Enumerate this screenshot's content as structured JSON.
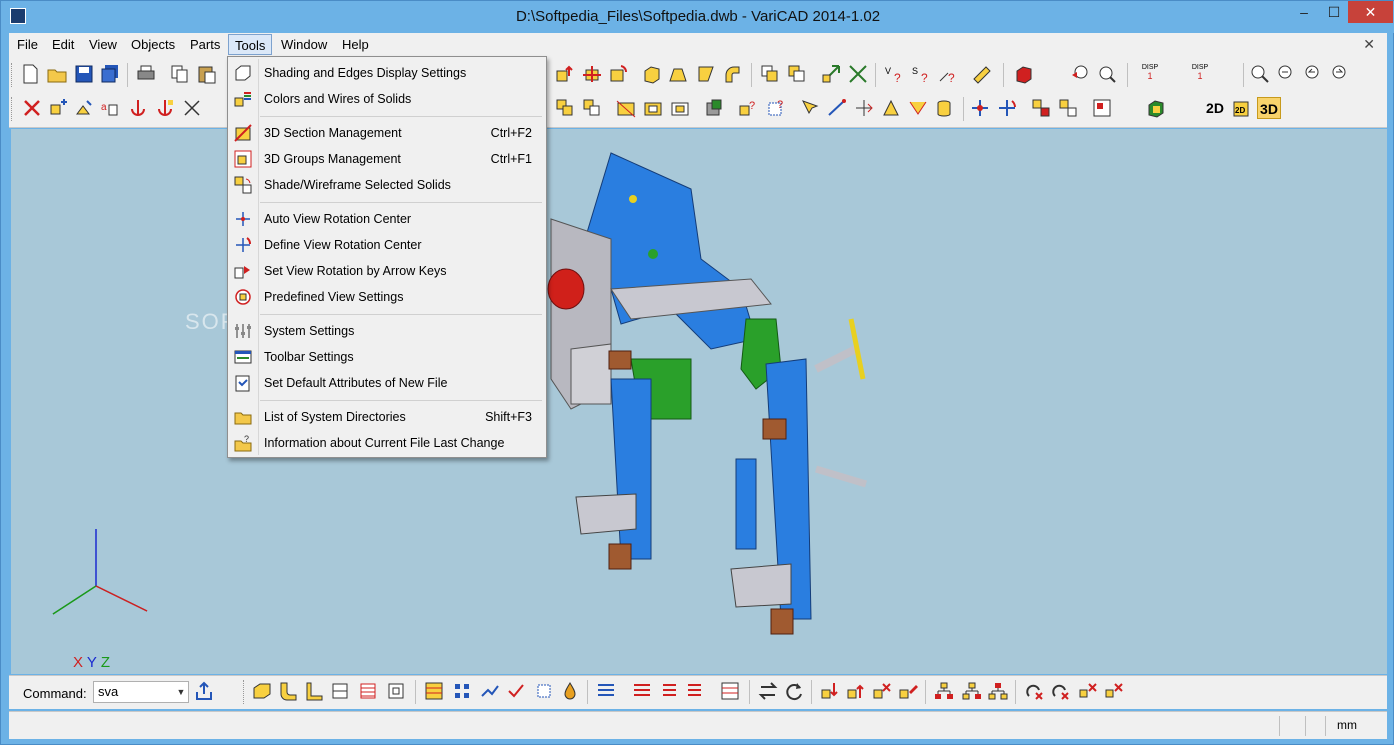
{
  "window": {
    "title": "D:\\Softpedia_Files\\Softpedia.dwb - VariCAD 2014-1.02",
    "min_glyph": "–",
    "max_glyph": "☐",
    "close_glyph": "✕",
    "mdi_close_glyph": "✕"
  },
  "menubar": {
    "items": [
      {
        "label": "File"
      },
      {
        "label": "Edit"
      },
      {
        "label": "View"
      },
      {
        "label": "Objects"
      },
      {
        "label": "Parts"
      },
      {
        "label": "Tools",
        "active": true
      },
      {
        "label": "Window"
      },
      {
        "label": "Help"
      }
    ]
  },
  "tools_menu": {
    "items": [
      {
        "label": "Shading and Edges Display Settings",
        "shortcut": "",
        "icon": "shading-icon"
      },
      {
        "label": "Colors and Wires of Solids",
        "shortcut": "",
        "icon": "colors-icon"
      },
      {
        "label": "3D Section Management",
        "shortcut": "Ctrl+F2",
        "icon": "section-icon"
      },
      {
        "label": "3D Groups Management",
        "shortcut": "Ctrl+F1",
        "icon": "groups-icon"
      },
      {
        "label": "Shade/Wireframe Selected Solids",
        "shortcut": "",
        "icon": "shade-wire-icon"
      },
      {
        "label": "Auto View Rotation Center",
        "shortcut": "",
        "icon": "auto-rotation-icon"
      },
      {
        "label": "Define View Rotation Center",
        "shortcut": "",
        "icon": "define-rotation-icon"
      },
      {
        "label": "Set View Rotation by Arrow Keys",
        "shortcut": "",
        "icon": "arrow-keys-icon"
      },
      {
        "label": "Predefined View Settings",
        "shortcut": "",
        "icon": "predefined-view-icon"
      },
      {
        "label": "System Settings",
        "shortcut": "",
        "icon": "system-settings-icon"
      },
      {
        "label": "Toolbar Settings",
        "shortcut": "",
        "icon": "toolbar-settings-icon"
      },
      {
        "label": "Set Default Attributes of New File",
        "shortcut": "",
        "icon": "default-attributes-icon"
      },
      {
        "label": "List of System Directories",
        "shortcut": "Shift+F3",
        "icon": "directories-icon"
      },
      {
        "label": "Information about Current File Last Change",
        "shortcut": "",
        "icon": "file-info-icon"
      }
    ]
  },
  "toolbar": {
    "view_2d_label": "2D",
    "view_3d_label": "3D",
    "disp_label": "DISP",
    "disp_1_label": "1"
  },
  "viewport": {
    "watermark": "SOFTPEDIA",
    "axis_x": "X",
    "axis_y": "Y",
    "axis_z": "Z",
    "background": "#a8c8d8"
  },
  "command": {
    "label": "Command:",
    "value": "sva"
  },
  "status": {
    "unit": "mm"
  },
  "colors": {
    "titlebar": "#6cb2e6",
    "part_blue": "#2a7ee0",
    "part_green": "#2aa02a",
    "part_gray": "#b8b8c0",
    "part_red": "#d0201a",
    "part_brown": "#a05a30",
    "part_yellow": "#e8d020"
  }
}
